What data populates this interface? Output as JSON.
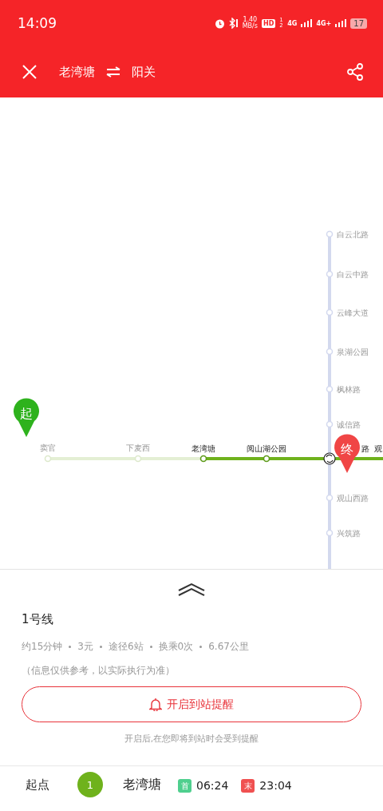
{
  "status_bar": {
    "time": "14:09",
    "speed": "1.40",
    "speed_unit": "MB/s",
    "hd": "HD",
    "sim": "1 2",
    "net_1": "4G",
    "net_2": "4G+",
    "battery": "17"
  },
  "header": {
    "from": "老湾塘",
    "to": "阳关"
  },
  "map": {
    "vertical_stations": [
      "白云北路",
      "白云中路",
      "云峰大道",
      "泉湖公园",
      "枫林路",
      "诚信路",
      "观山西路",
      "兴筑路"
    ],
    "route_stations": [
      {
        "name": "窦官",
        "on_route": false
      },
      {
        "name": "下麦西",
        "on_route": false
      },
      {
        "name": "老湾塘",
        "on_route": true
      },
      {
        "name": "阅山湖公园",
        "on_route": true
      }
    ],
    "cut_labels": [
      "路",
      "观"
    ],
    "start_marker": "起",
    "end_marker": "终"
  },
  "panel": {
    "line_name": "1号线",
    "stats": [
      "约15分钟",
      "3元",
      "途径6站",
      "换乘0次",
      "6.67公里"
    ],
    "note": "（信息仅供参考，以实际执行为准）",
    "remind_button": "开启到站提醒",
    "remind_hint": "开启后,在您即将到站时会受到提醒",
    "first_row": {
      "label": "起点",
      "line_number": "1",
      "station": "老湾塘",
      "first_tag": "首",
      "first_time": "06:24",
      "last_tag": "末",
      "last_time": "23:04"
    }
  }
}
